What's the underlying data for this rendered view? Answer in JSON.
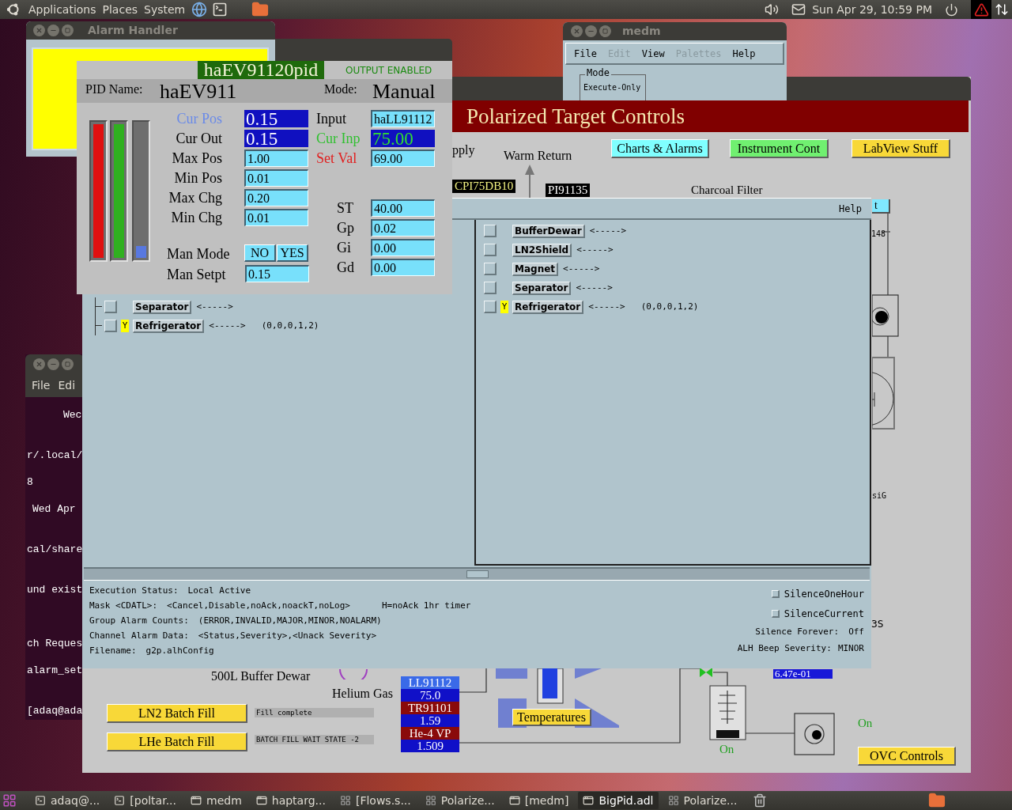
{
  "top_panel": {
    "menus": [
      "Applications",
      "Places",
      "System"
    ],
    "clock": "Sun Apr 29, 10:59 PM"
  },
  "terminal": {
    "menus": [
      "File",
      "Edi"
    ],
    "lines": [
      "Wec",
      "r/.local/",
      "8",
      "Wed Apr",
      "cal/share",
      "und exist",
      "ch Reques",
      "alarm_set",
      "[adaq@ada"
    ]
  },
  "alarm_mini": {
    "title": "Alarm Handler"
  },
  "medm": {
    "title": "medm",
    "menus": [
      {
        "label": "File",
        "disabled": false
      },
      {
        "label": "Edit",
        "disabled": true
      },
      {
        "label": "View",
        "disabled": false
      },
      {
        "label": "Palettes",
        "disabled": true
      },
      {
        "label": "Help",
        "disabled": false
      }
    ],
    "mode": {
      "title": "Mode",
      "value": "Execute-Only"
    }
  },
  "controls": {
    "header": "Polarized Target Controls",
    "supply_label": "pply",
    "warm_return_label": "Warm Return",
    "charcoal_filter_label": "Charcoal Filter",
    "nav_buttons": [
      {
        "label": "Charts & Alarms",
        "color": "#80ffff"
      },
      {
        "label": "Instrument Cont",
        "color": "#70f070"
      },
      {
        "label": "LabView Stuff",
        "color": "#f8d838"
      }
    ],
    "tags": [
      {
        "label": "CPI75DB10",
        "kind": "setpoint"
      },
      {
        "label": "PI91135",
        "kind": "reading"
      }
    ],
    "side_button": "t",
    "edge_labels": [
      "148",
      "siG",
      "3S"
    ],
    "buffer_dewar_label": "500L Buffer Dewar",
    "helium_gas_label": "Helium Gas",
    "fill_buttons": [
      {
        "label": "LN2 Batch Fill",
        "status": "Fill complete"
      },
      {
        "label": "LHe Batch Fill",
        "status": "BATCH FILL WAIT STATE -2"
      }
    ],
    "readouts": [
      {
        "label": "LL91112",
        "value": "75.0",
        "color": "#3a6ae8"
      },
      {
        "label": "TR91101",
        "value": "1.59",
        "color": "#8a0a0a"
      },
      {
        "label": "He-4 VP",
        "value": "1.509",
        "color": "#8a0a0a"
      }
    ],
    "temperatures_button": "Temperatures",
    "pressure_value": "6.47e-01",
    "pump_states": [
      "On",
      "On"
    ],
    "ovc_button": "OVC Controls"
  },
  "alarm_handler": {
    "menus": [
      "Help"
    ],
    "tree": [
      {
        "name": "Separator",
        "checked": false,
        "arrow": "<----->"
      },
      {
        "name": "Refrigerator",
        "checked": false,
        "flag": "Y",
        "arrow": "<----->",
        "counts": "(0,0,0,1,2)"
      }
    ],
    "list": [
      {
        "name": "BufferDewar",
        "checked": false,
        "arrow": "<----->"
      },
      {
        "name": "LN2Shield",
        "checked": false,
        "arrow": "<----->"
      },
      {
        "name": "Magnet",
        "checked": false,
        "arrow": "<----->"
      },
      {
        "name": "Separator",
        "checked": false,
        "arrow": "<----->"
      },
      {
        "name": "Refrigerator",
        "checked": false,
        "flag": "Y",
        "arrow": "<----->",
        "counts": "(0,0,0,1,2)"
      }
    ],
    "status_lines": [
      {
        "label": "Execution Status:",
        "value": "Local Active"
      },
      {
        "label": "Mask <CDATL>:",
        "value": "<Cancel,Disable,noAck,noackT,noLog>",
        "note": "H=noAck 1hr timer"
      },
      {
        "label": "Group Alarm Counts:",
        "value": "(ERROR,INVALID,MAJOR,MINOR,NOALARM)"
      },
      {
        "label": "Channel Alarm Data:",
        "value": "<Status,Severity>,<Unack Severity>"
      },
      {
        "label": "Filename:",
        "value": "g2p.alhConfig"
      }
    ],
    "silence_toggles": [
      {
        "label": "SilenceOneHour",
        "checked": false
      },
      {
        "label": "SilenceCurrent",
        "checked": false
      }
    ],
    "silence_forever": {
      "label": "Silence Forever:",
      "value": "Off"
    },
    "beep": {
      "label": "ALH Beep Severity:",
      "value": "MINOR"
    }
  },
  "pid": {
    "title": "haEV91120pid",
    "output": "OUTPUT ENABLED",
    "name_label": "PID Name:",
    "name": "haEV911",
    "mode_label": "Mode:",
    "mode": "Manual",
    "bars": [
      {
        "color": "#e01010",
        "level": 1
      },
      {
        "color": "#30b020",
        "level": 1
      },
      {
        "color": "#5878e0",
        "level": 0.09
      }
    ],
    "left_fields": [
      {
        "label": "Cur Pos",
        "value": "0.15",
        "kind": "readback",
        "color": "#6a8ae8"
      },
      {
        "label": "Cur Out",
        "value": "0.15",
        "kind": "readback",
        "color": "#000000"
      },
      {
        "label": "Max Pos",
        "value": "1.00",
        "kind": "entry",
        "color": "#000000"
      },
      {
        "label": "Min Pos",
        "value": "0.01",
        "kind": "entry",
        "color": "#000000"
      },
      {
        "label": "Max Chg",
        "value": "0.20",
        "kind": "entry",
        "color": "#000000"
      },
      {
        "label": "Min Chg",
        "value": "0.01",
        "kind": "entry",
        "color": "#000000"
      }
    ],
    "man_mode": {
      "label": "Man Mode",
      "buttons": [
        "NO",
        "YES"
      ]
    },
    "man_setpt": {
      "label": "Man Setpt",
      "value": "0.15"
    },
    "right_fields": [
      {
        "label": "Input",
        "value": "haLL91112",
        "kind": "entry",
        "color": "#000000"
      },
      {
        "label": "Cur Inp",
        "value": "75.00",
        "kind": "monitor",
        "color": "#30c030"
      },
      {
        "label": "Set Val",
        "value": "69.00",
        "kind": "entry",
        "color": "#e02020"
      }
    ],
    "gains": [
      {
        "label": "ST",
        "value": "40.00"
      },
      {
        "label": "Gp",
        "value": "0.02"
      },
      {
        "label": "Gi",
        "value": "0.00"
      },
      {
        "label": "Gd",
        "value": "0.00"
      }
    ]
  },
  "taskbar": {
    "items": [
      {
        "label": "adaq@...",
        "kind": "terminal",
        "selected": false
      },
      {
        "label": "[poltar...",
        "kind": "terminal",
        "selected": false
      },
      {
        "label": "medm",
        "kind": "window",
        "selected": false
      },
      {
        "label": "haptarg...",
        "kind": "window",
        "selected": false
      },
      {
        "label": "[Flows.s...",
        "kind": "display",
        "selected": false
      },
      {
        "label": "Polarize...",
        "kind": "display",
        "selected": false
      },
      {
        "label": "[medm]",
        "kind": "window",
        "selected": false
      },
      {
        "label": "BigPid.adl",
        "kind": "window",
        "selected": true
      },
      {
        "label": "Polarize...",
        "kind": "display",
        "selected": false
      }
    ]
  }
}
